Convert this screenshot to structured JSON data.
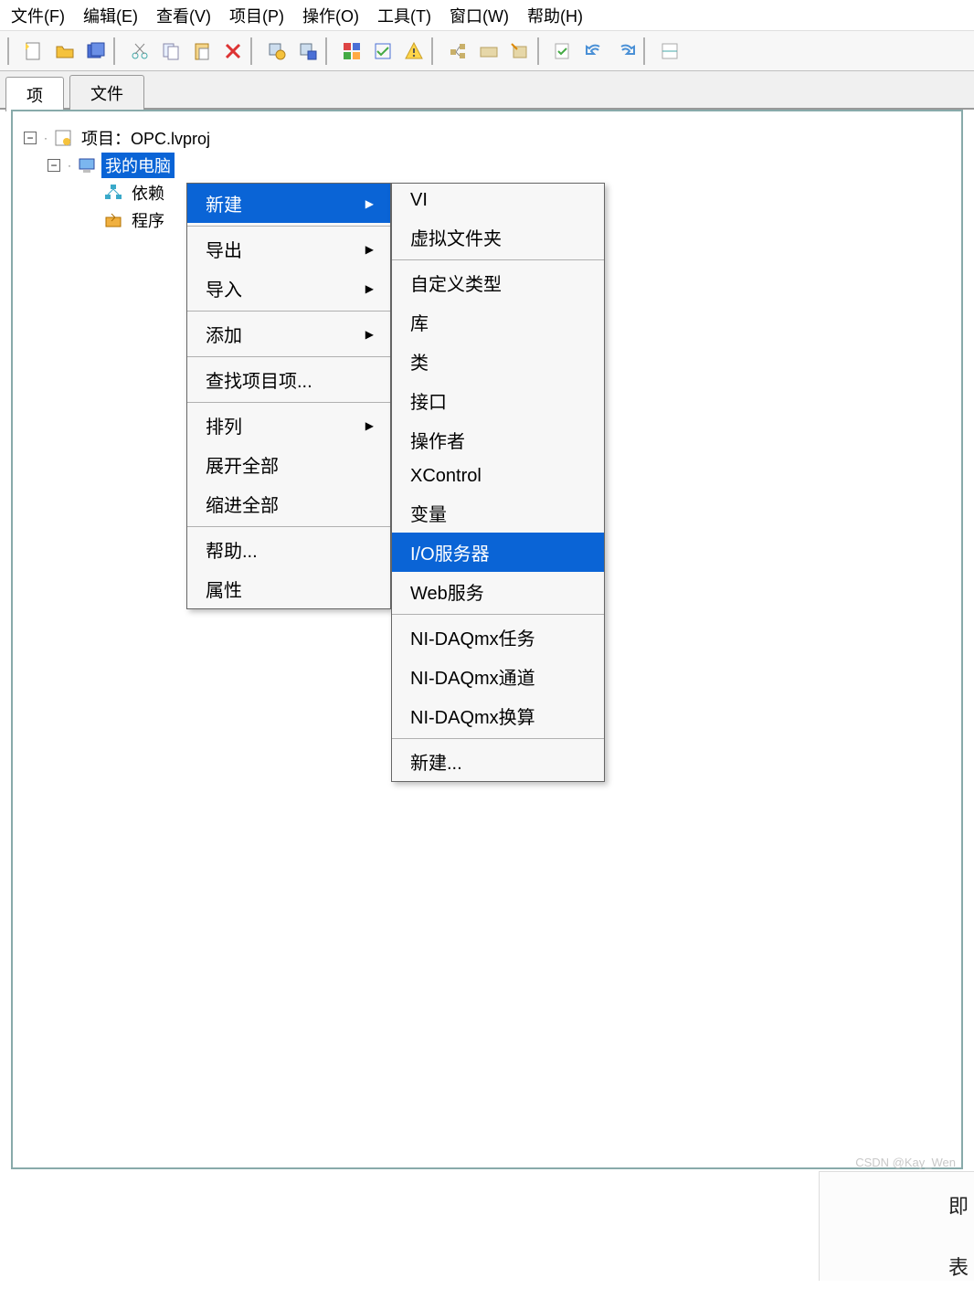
{
  "menubar": {
    "file": "文件(F)",
    "edit": "编辑(E)",
    "view": "查看(V)",
    "project": "项目(P)",
    "operate": "操作(O)",
    "tools": "工具(T)",
    "window": "窗口(W)",
    "help": "帮助(H)"
  },
  "toolbar_icons": {
    "new": "new-file-icon",
    "open": "open-folder-icon",
    "save_all": "save-all-icon",
    "cut": "cut-icon",
    "copy": "copy-icon",
    "paste": "paste-icon",
    "delete": "delete-icon",
    "cfg1": "config-gear-a-icon",
    "cfg2": "config-gear-b-icon",
    "pal": "palette-icon",
    "res": "resolve-icon",
    "warn": "warning-icon",
    "dep1": "dependency-a-icon",
    "dep2": "dependency-b-icon",
    "dep3": "dependency-c-icon",
    "run": "run-check-icon",
    "undo": "undo-icon",
    "redo": "redo-icon",
    "other": "misc-icon"
  },
  "tabs": {
    "project": "项",
    "files": "文件"
  },
  "tree": {
    "root_label": "项目：OPC.lvproj",
    "my_computer": "我的电脑",
    "dependencies": "依赖",
    "build_specs": "程序"
  },
  "context_menu": {
    "new": "新建",
    "export": "导出",
    "import": "导入",
    "add": "添加",
    "find_project_items": "查找项目项...",
    "arrange": "排列",
    "expand_all": "展开全部",
    "collapse_all": "缩进全部",
    "help": "帮助...",
    "properties": "属性"
  },
  "submenu": {
    "vi": "VI",
    "virtual_folder": "虚拟文件夹",
    "custom_type": "自定义类型",
    "library": "库",
    "class": "类",
    "interface": "接口",
    "actor": "操作者",
    "xcontrol": "XControl",
    "variable": "变量",
    "io_server": "I/O服务器",
    "web_service": "Web服务",
    "ni_daqmx_task": "NI-DAQmx任务",
    "ni_daqmx_channel": "NI-DAQmx通道",
    "ni_daqmx_scale": "NI-DAQmx换算",
    "new": "新建..."
  },
  "bottom_panel": {
    "line1": "即",
    "line2": "表"
  },
  "watermark": "CSDN @Kay_Wen"
}
